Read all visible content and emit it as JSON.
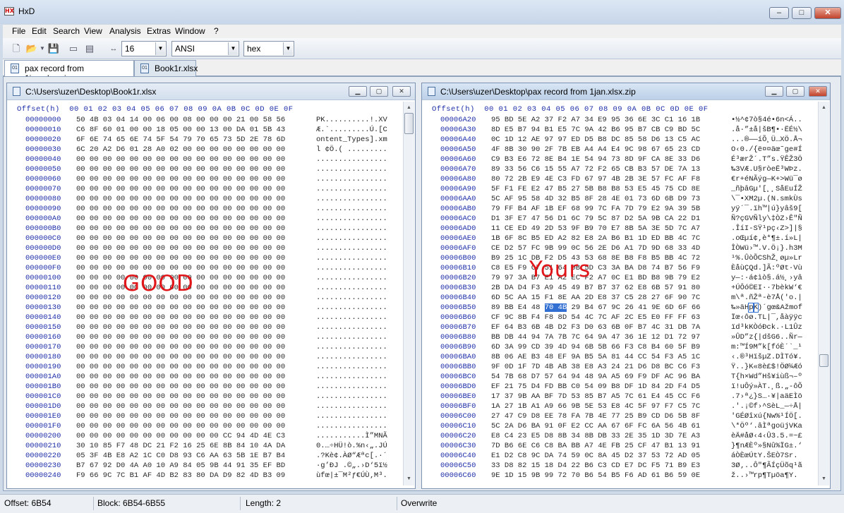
{
  "window": {
    "title": "HxD",
    "app_icon": "hxd-logo",
    "minimize": "–",
    "maximize": "□",
    "close": "✕"
  },
  "menu": [
    "File",
    "Edit",
    "Search",
    "View",
    "Analysis",
    "Extras",
    "Window",
    "?"
  ],
  "toolbar": {
    "bytes_per_row": "16",
    "charset": "ANSI",
    "offset_base": "hex",
    "icons": [
      "new-file-icon",
      "open-file-icon",
      "dropdown-icon",
      "save-icon",
      "open-disk-icon",
      "open-ram-icon",
      "bytes-per-row-icon"
    ]
  },
  "tabs": [
    {
      "label": "pax record from 1jan.xlsx.zip",
      "active": true
    },
    {
      "label": "Book1r.xlsx",
      "active": false
    }
  ],
  "left_pane": {
    "path": "C:\\Users\\uzer\\Desktop\\Book1r.xlsx",
    "overlay_label": "GOOD",
    "header": "Offset(h)  00 01 02 03 04 05 06 07 08 09 0A 0B 0C 0D 0E 0F",
    "rows": [
      {
        "off": "00000000",
        "hex": "50 4B 03 04 14 00 06 00 08 00 00 00 21 00 58 56",
        "txt": "PK..........!.XV"
      },
      {
        "off": "00000010",
        "hex": "C6 8F 60 01 00 00 18 05 00 00 13 00 DA 01 5B 43",
        "txt": "Æ.`.........Ú.[C"
      },
      {
        "off": "00000020",
        "hex": "6F 6E 74 65 6E 74 5F 54 79 70 65 73 5D 2E 78 6D",
        "txt": "ontent_Types].xm"
      },
      {
        "off": "00000030",
        "hex": "6C 20 A2 D6 01 28 A0 02 00 00 00 00 00 00 00 00",
        "txt": "l ¢Ö.( ........."
      },
      {
        "off": "00000040",
        "hex": "00 00 00 00 00 00 00 00 00 00 00 00 00 00 00 00",
        "txt": "................"
      },
      {
        "off": "00000050",
        "hex": "00 00 00 00 00 00 00 00 00 00 00 00 00 00 00 00",
        "txt": "................"
      },
      {
        "off": "00000060",
        "hex": "00 00 00 00 00 00 00 00 00 00 00 00 00 00 00 00",
        "txt": "................"
      },
      {
        "off": "00000070",
        "hex": "00 00 00 00 00 00 00 00 00 00 00 00 00 00 00 00",
        "txt": "................"
      },
      {
        "off": "00000080",
        "hex": "00 00 00 00 00 00 00 00 00 00 00 00 00 00 00 00",
        "txt": "................"
      },
      {
        "off": "00000090",
        "hex": "00 00 00 00 00 00 00 00 00 00 00 00 00 00 00 00",
        "txt": "................"
      },
      {
        "off": "000000A0",
        "hex": "00 00 00 00 00 00 00 00 00 00 00 00 00 00 00 00",
        "txt": "................"
      },
      {
        "off": "000000B0",
        "hex": "00 00 00 00 00 00 00 00 00 00 00 00 00 00 00 00",
        "txt": "................"
      },
      {
        "off": "000000C0",
        "hex": "00 00 00 00 00 00 00 00 00 00 00 00 00 00 00 00",
        "txt": "................"
      },
      {
        "off": "000000D0",
        "hex": "00 00 00 00 00 00 00 00 00 00 00 00 00 00 00 00",
        "txt": "................"
      },
      {
        "off": "000000E0",
        "hex": "00 00 00 00 00 00 00 00 00 00 00 00 00 00 00 00",
        "txt": "................"
      },
      {
        "off": "000000F0",
        "hex": "00 00 00 00 00 00 00 00 00 00 00 00 00 00 00 00",
        "txt": "................"
      },
      {
        "off": "00000100",
        "hex": "00 00 00 00 00 00 00 00 00 00 00 00 00 00 00 00",
        "txt": "................"
      },
      {
        "off": "00000110",
        "hex": "00 00 00 00 00 00 00 00 00 00 00 00 00 00 00 00",
        "txt": "................"
      },
      {
        "off": "00000120",
        "hex": "00 00 00 00 00 00 00 00 00 00 00 00 00 00 00 00",
        "txt": "................"
      },
      {
        "off": "00000130",
        "hex": "00 00 00 00 00 00 00 00 00 00 00 00 00 00 00 00",
        "txt": "................"
      },
      {
        "off": "00000140",
        "hex": "00 00 00 00 00 00 00 00 00 00 00 00 00 00 00 00",
        "txt": "................"
      },
      {
        "off": "00000150",
        "hex": "00 00 00 00 00 00 00 00 00 00 00 00 00 00 00 00",
        "txt": "................"
      },
      {
        "off": "00000160",
        "hex": "00 00 00 00 00 00 00 00 00 00 00 00 00 00 00 00",
        "txt": "................"
      },
      {
        "off": "00000170",
        "hex": "00 00 00 00 00 00 00 00 00 00 00 00 00 00 00 00",
        "txt": "................"
      },
      {
        "off": "00000180",
        "hex": "00 00 00 00 00 00 00 00 00 00 00 00 00 00 00 00",
        "txt": "................"
      },
      {
        "off": "00000190",
        "hex": "00 00 00 00 00 00 00 00 00 00 00 00 00 00 00 00",
        "txt": "................"
      },
      {
        "off": "000001A0",
        "hex": "00 00 00 00 00 00 00 00 00 00 00 00 00 00 00 00",
        "txt": "................"
      },
      {
        "off": "000001B0",
        "hex": "00 00 00 00 00 00 00 00 00 00 00 00 00 00 00 00",
        "txt": "................"
      },
      {
        "off": "000001C0",
        "hex": "00 00 00 00 00 00 00 00 00 00 00 00 00 00 00 00",
        "txt": "................"
      },
      {
        "off": "000001D0",
        "hex": "00 00 00 00 00 00 00 00 00 00 00 00 00 00 00 00",
        "txt": "................"
      },
      {
        "off": "000001E0",
        "hex": "00 00 00 00 00 00 00 00 00 00 00 00 00 00 00 00",
        "txt": "................"
      },
      {
        "off": "000001F0",
        "hex": "00 00 00 00 00 00 00 00 00 00 00 00 00 00 00 00",
        "txt": "................"
      },
      {
        "off": "00000200",
        "hex": "00 00 00 00 00 00 00 00 00 00 00 CC 94 4D 4E C3",
        "txt": "...........Ì”MNÃ"
      },
      {
        "off": "00000210",
        "hex": "30 10 85 F7 48 DC 21 F2 16 25 6E 8B 84 10 4A DA",
        "txt": "0.…÷HÜ!ò.%n‹„.JÚ"
      },
      {
        "off": "00000220",
        "hex": "05 3F 4B E8 A2 1C C0 D8 93 C6 AA 63 5B 1E B7 B4",
        "txt": ".?Kè¢.ÀØ“Æªc[.·´"
      },
      {
        "off": "00000230",
        "hex": "B7 67 92 D0 4A A0 10 A9 84 05 9B 44 91 35 EF BD",
        "txt": "·g’ÐJ .©„.›D‘5ï½"
      },
      {
        "off": "00000240",
        "hex": "F9 66 9C 7C B1 AF 4D B2 83 80 DA D9 82 4D B3 09",
        "txt": "ùfœ|±¯M²ƒ€ÚÙ‚M³."
      }
    ]
  },
  "right_pane": {
    "path": "C:\\Users\\uzer\\Desktop\\pax record from 1jan.xlsx.zip",
    "overlay_label": "Yours",
    "header": "Offset(h)  00 01 02 03 04 05 06 07 08 09 0A 0B 0C 0D 0E 0F",
    "rows": [
      {
        "off": "00006A20",
        "hex": "95 BD 5E A2 37 F2 A7 34 E9 95 36 6E 3C C1 16 1B",
        "txt": "•½^¢7ò§4é•6n<Á.."
      },
      {
        "off": "00006A30",
        "hex": "8D E5 B7 94 B1 E5 7C 9A 42 B6 95 B7 CB C9 BD 5C",
        "txt": ".å·”±å|šB¶•·ËÉ½\\"
      },
      {
        "off": "00006A40",
        "hex": "0C 1D 12 AE 97 97 ED D5 B8 DC 85 58 D6 13 C5 AC",
        "txt": "...®——íÕ¸Ü…XÖ.Å¬"
      },
      {
        "off": "00006A50",
        "hex": "4F 8B 30 90 2F 7B EB A4 A4 E4 9C 98 67 65 23 CD",
        "txt": "O‹0./{ë¤¤äœ˜ge#Í"
      },
      {
        "off": "00006A60",
        "hex": "C9 B3 E6 72 8E B4 1E 54 94 73 8D 9F CA 8E 33 D6",
        "txt": "É³ærŽ´.T”s.ŸÊŽ3Ö"
      },
      {
        "off": "00006A70",
        "hex": "89 33 56 C6 15 55 A7 72 F2 65 CB B3 57 DE 7A 13",
        "txt": "‰3VÆ.U§ròeË³WÞz."
      },
      {
        "off": "00006A80",
        "hex": "80 72 2B E9 4E C3 FD 67 97 4B 2B 3E 57 FC AF F8",
        "txt": "€r+éNÃýg—K+>Wü¯ø"
      },
      {
        "off": "00006A90",
        "hex": "5F F1 FE E2 47 B5 27 5B B8 B8 53 E5 45 75 CD 8E",
        "txt": "_ñþâGµ'[¸¸SåEuÍŽ"
      },
      {
        "off": "00006AA0",
        "hex": "5C AF 95 58 4D 32 B5 8F 28 4E 01 73 6D 6B D9 73",
        "txt": "\\¯•XM2µ.(N.smkÙs"
      },
      {
        "off": "00006AB0",
        "hex": "79 FF B4 AF 1B EF 68 99 7C FA 7D 79 E2 9A 39 5B",
        "txt": "yÿ´¯.ïh™|ú}yâš9["
      },
      {
        "off": "00006AC0",
        "hex": "D1 3F E7 47 56 D1 6C 79 5C 87 D2 5A 9B CA 22 D1",
        "txt": "Ñ?çGVÑly\\‡ÒZ›Ê\"Ñ"
      },
      {
        "off": "00006AD0",
        "hex": "11 CE ED 49 2D 53 9F B9 70 E7 8B 5A 3E 5D 7C A7",
        "txt": ".ÎíI-SŸ¹pç‹Z>]|§"
      },
      {
        "off": "00006AE0",
        "hex": "1B 6F 8C B5 ED A2 82 E8 2A B6 B1 1D ED BB 4C 7C",
        "txt": ".oŒµí¢‚è*¶±.í»L|"
      },
      {
        "off": "00006AF0",
        "hex": "CE D2 57 FC 9B 99 0C 56 2E D6 A1 7D 9D 68 33 4D",
        "txt": "ÎÒWü›™.V.Ö¡}.h3M"
      },
      {
        "off": "00006B00",
        "hex": "B9 25 1C DB F2 D5 43 53 68 8E B8 F8 B5 BB 4C 72",
        "txt": "¹%.ÛòÕCShŽ¸øµ»Lr"
      },
      {
        "off": "00006B10",
        "hex": "C8 E5 F9 C7 51 64 0B 5D C3 3A BA D8 74 B7 56 F9",
        "txt": "ÈåùÇQd.]Ã:ºØt·Vù"
      },
      {
        "off": "00006B20",
        "hex": "79 97 3A B7 E1 A2 EC F2 A7 0C E1 BD B8 9B 79 E2",
        "txt": "y—:·á¢ìò§.á½¸›yâ"
      },
      {
        "off": "00006B30",
        "hex": "2B DA D4 F3 A9 45 49 B7 B7 37 62 E8 6B 57 91 80",
        "txt": "+ÚÔó©EI··7bèkW‘€"
      },
      {
        "off": "00006B40",
        "hex": "6D 5C AA 15 F1 8E AA 2D E8 37 C5 28 27 6F 90 7C",
        "txt": "m\\ª.ñŽª-è7Å('o.|"
      },
      {
        "off": "00006B50",
        "hex": "89 BB E4 48 70 4B 29 B4 67 9C 26 41 9E 6D 6F 66",
        "txt": "‰»äHpK)´gœ&Ažmof"
      },
      {
        "off": "00006B60",
        "hex": "CF 9C 8B F4 F8 8D 54 4C 7C AF 2C E5 E0 FF FF 63",
        "txt": "Ïœ‹ôø.TL|¯,åàÿÿc"
      },
      {
        "off": "00006B70",
        "hex": "EF 64 B3 6B 4B D2 F3 D0 63 6B 0F B7 4C 31 DB 7A",
        "txt": "ïd³kKÒóÐck.·L1Ûz"
      },
      {
        "off": "00006B80",
        "hex": "BB DB 44 94 7A 7B 7C 64 9A 47 36 1E 12 D1 72 97",
        "txt": "»ÛD”z{|dšG6..Ñr—"
      },
      {
        "off": "00006B90",
        "hex": "6D 3A 99 CD 39 4D 94 6B 5B 66 F3 C8 B4 60 5F B9",
        "txt": "m:™Í9M”k[fóÈ´`_¹"
      },
      {
        "off": "00006BA0",
        "hex": "8B 06 AE B3 48 EF 9A B5 5A 81 44 CC 54 F3 A5 1C",
        "txt": "‹.®³HïšµZ.DÌTó¥."
      },
      {
        "off": "00006BB0",
        "hex": "9F 0D 1F 7D 4B AB 38 E8 A3 24 21 D6 D8 BC C6 F3",
        "txt": "Ÿ..}K«8è£$!ÖØ¼Æó"
      },
      {
        "off": "00006BC0",
        "hex": "54 7B 68 D7 57 64 94 48 9A A5 69 F9 DF AC 96 BA",
        "txt": "T{h×Wd”Hš¥iùß¬–º"
      },
      {
        "off": "00006BD0",
        "hex": "EF 21 75 D4 FD BB C0 54 09 B8 DF 1D 84 2D F4 D5",
        "txt": "ï!uÔý»ÀT.¸ß.„-ôÕ"
      },
      {
        "off": "00006BE0",
        "hex": "17 37 9B AA BF 7D 53 85 B7 A5 7C 61 E4 45 CC F6",
        "txt": ".7›ª¿}S…·¥|aäEÌö"
      },
      {
        "off": "00006BF0",
        "hex": "1A 27 1B A1 A9 66 9B 5E 53 E8 4C 5F 97 F7 C5 7C",
        "txt": ".'.¡©f›^SèL_—÷Å|"
      },
      {
        "off": "00006C00",
        "hex": "27 47 C9 D8 EE 78 FA 7B 4E 77 25 B9 CD D6 5B 8F",
        "txt": "'GÉØîxú{Nw%¹ÍÖ[."
      },
      {
        "off": "00006C10",
        "hex": "5C 2A D6 BA 91 0F E2 CC AA 67 6F FC 6A 56 4B 61",
        "txt": "\\*Öº‘.âÌªgoüjVKa"
      },
      {
        "off": "00006C20",
        "hex": "E8 C4 23 E5 D8 8B 34 8B DB 33 2E 35 1D 3D 7E A3",
        "txt": "èÄ#åØ‹4‹Û3.5.=~£"
      },
      {
        "off": "00006C30",
        "hex": "7D B6 6E C6 C8 BA BB A7 4E FB 25 CF 47 B1 13 91",
        "txt": "}¶nÆÈº»§Nû%ÏG±.‘"
      },
      {
        "off": "00006C40",
        "hex": "E1 D2 C8 9C DA 74 59 0C 8A 45 D2 37 53 72 AD 05",
        "txt": "áÒÈœÚtY.ŠEÒ7Sr­."
      },
      {
        "off": "00006C50",
        "hex": "33 D8 82 15 18 D4 22 B6 C3 CD E7 DC F5 71 B9 E3",
        "txt": "3Ø‚..Ô\"¶ÃÍçÜõq¹ã"
      },
      {
        "off": "00006C60",
        "hex": "9E 1D 15 9B 99 72 70 B6 54 B5 F6 AD 61 B6 59 0E",
        "txt": "ž..›™rp¶Tµö­a¶Y."
      }
    ],
    "selection": {
      "row": 19,
      "start": 4,
      "end": 5
    }
  },
  "status": {
    "offset": "Offset: 6B54",
    "block": "Block: 6B54-6B55",
    "length": "Length: 2",
    "mode": "Overwrite"
  }
}
